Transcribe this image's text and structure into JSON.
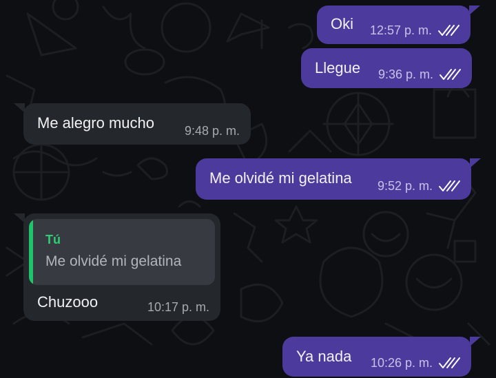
{
  "colors": {
    "outgoing_bubble": "#4c3a9c",
    "incoming_bubble": "#24272b",
    "background": "#0e0f12",
    "quote_accent": "#1fc36b"
  },
  "messages": [
    {
      "direction": "outgoing",
      "text": "Oki",
      "time": "12:57 p. m.",
      "status": "read-double-check-icon"
    },
    {
      "direction": "outgoing",
      "text": "Llegue",
      "time": "9:36 p. m.",
      "status": "read-double-check-icon"
    },
    {
      "direction": "incoming",
      "text": "Me alegro mucho",
      "time": "9:48 p. m."
    },
    {
      "direction": "outgoing",
      "text": "Me olvidé mi gelatina",
      "time": "9:52 p. m.",
      "status": "read-double-check-icon"
    },
    {
      "direction": "incoming",
      "text": "Chuzooo",
      "time": "10:17 p. m.",
      "quote": {
        "author": "Tú",
        "text": "Me olvidé mi gelatina"
      }
    },
    {
      "direction": "outgoing",
      "text": "Ya nada",
      "time": "10:26 p. m.",
      "status": "read-double-check-icon"
    }
  ]
}
